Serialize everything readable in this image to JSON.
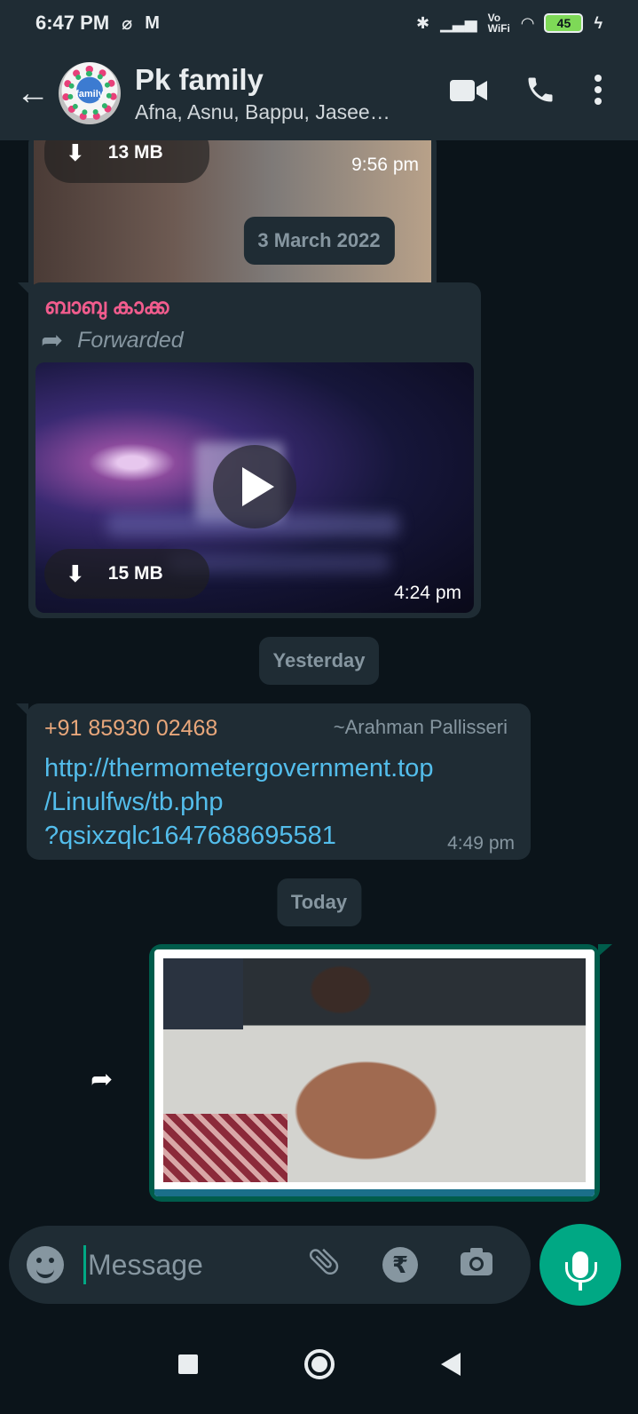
{
  "status_bar": {
    "time": "6:47 PM",
    "app_icons": [
      "vpn-icon",
      "gmail-icon"
    ],
    "indicators": [
      "bluetooth-icon",
      "signal-icon",
      "vowifi-icon",
      "wifi-icon"
    ],
    "vowifi_label": "Vo WiFi",
    "battery": "45"
  },
  "header": {
    "chat_name": "Pk family",
    "members": "Afna, Asnu, Bappu, Jasee…",
    "avatar_text": "family"
  },
  "messages": {
    "media_top": {
      "size": "13 MB",
      "time": "9:56 pm"
    },
    "date_1": "3 March 2022",
    "video_msg": {
      "sender": "ബാബു കാക്ക",
      "forwarded": "Forwarded",
      "size": "15 MB",
      "time": "4:24 pm"
    },
    "date_2": "Yesterday",
    "link_msg": {
      "sender_number": "+91 85930 02468",
      "sender_alias": "~Arahman Pallisseri",
      "line1": "http://thermometergovernment.top",
      "line2": "/Linulfws/tb.php",
      "line3": "?qsixzqlc1647688695581",
      "time": "4:49 pm"
    },
    "date_3": "Today"
  },
  "input": {
    "placeholder": "Message",
    "rupee_symbol": "₹"
  },
  "colors": {
    "accent": "#00a884",
    "header_bg": "#1f2c34",
    "chat_bg": "#0b141a",
    "outgoing_bubble": "#005c4b",
    "link": "#53bdeb"
  }
}
